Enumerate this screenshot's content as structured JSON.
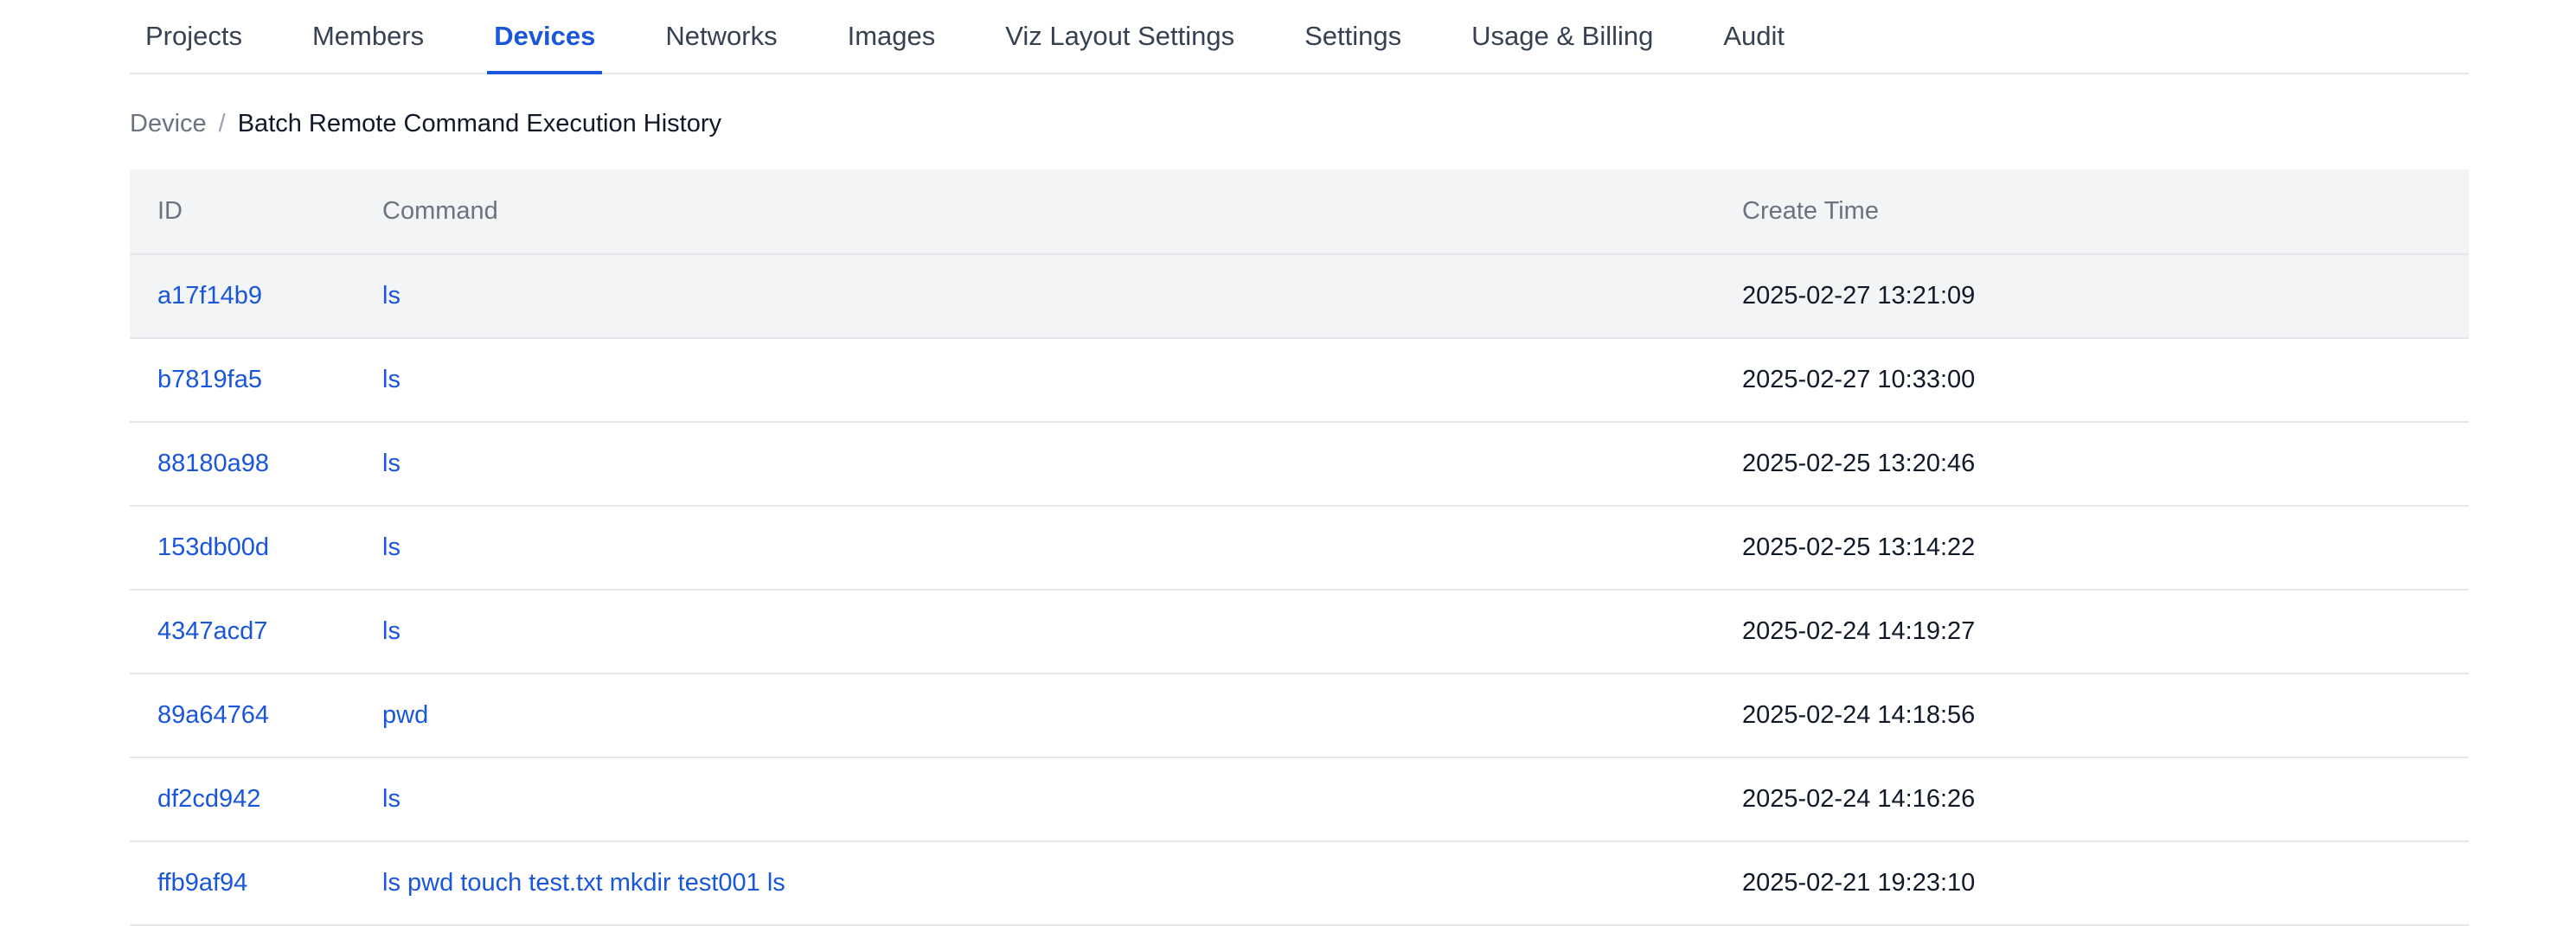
{
  "nav": {
    "tabs": [
      {
        "label": "Projects",
        "active": false
      },
      {
        "label": "Members",
        "active": false
      },
      {
        "label": "Devices",
        "active": true
      },
      {
        "label": "Networks",
        "active": false
      },
      {
        "label": "Images",
        "active": false
      },
      {
        "label": "Viz Layout Settings",
        "active": false
      },
      {
        "label": "Settings",
        "active": false
      },
      {
        "label": "Usage & Billing",
        "active": false
      },
      {
        "label": "Audit",
        "active": false
      }
    ]
  },
  "breadcrumb": {
    "root": "Device",
    "separator": "/",
    "current": "Batch Remote Command Execution History"
  },
  "table": {
    "columns": [
      "ID",
      "Command",
      "Create Time"
    ],
    "rows": [
      {
        "id": "a17f14b9",
        "command": "ls",
        "create_time": "2025-02-27 13:21:09"
      },
      {
        "id": "b7819fa5",
        "command": "ls",
        "create_time": "2025-02-27 10:33:00"
      },
      {
        "id": "88180a98",
        "command": "ls",
        "create_time": "2025-02-25 13:20:46"
      },
      {
        "id": "153db00d",
        "command": "ls",
        "create_time": "2025-02-25 13:14:22"
      },
      {
        "id": "4347acd7",
        "command": "ls",
        "create_time": "2025-02-24 14:19:27"
      },
      {
        "id": "89a64764",
        "command": "pwd",
        "create_time": "2025-02-24 14:18:56"
      },
      {
        "id": "df2cd942",
        "command": "ls",
        "create_time": "2025-02-24 14:16:26"
      },
      {
        "id": "ffb9af94",
        "command": "ls pwd touch test.txt mkdir test001 ls",
        "create_time": "2025-02-21 19:23:10"
      }
    ]
  },
  "colors": {
    "accent": "#1a56db",
    "header_bg": "#f3f4f6",
    "border": "#e5e7eb"
  }
}
